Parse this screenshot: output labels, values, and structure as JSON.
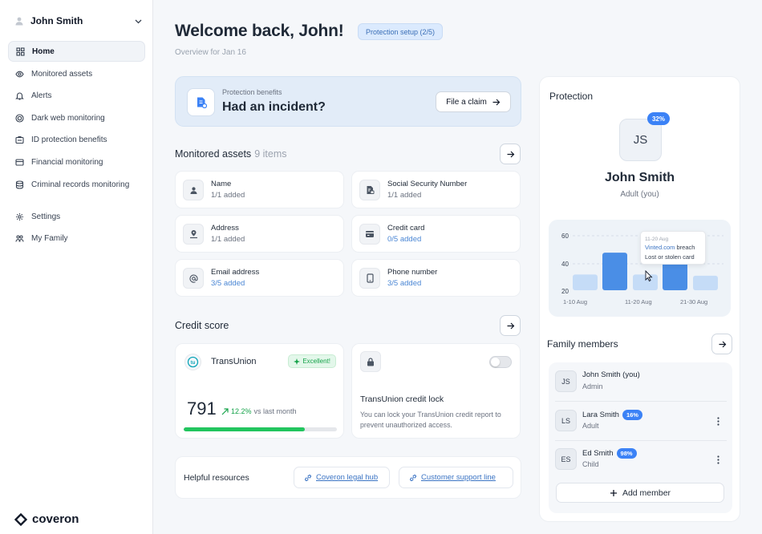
{
  "sidebar": {
    "user_name": "John Smith",
    "items": [
      {
        "label": "Home",
        "icon": "grid-icon",
        "active": true
      },
      {
        "label": "Monitored assets",
        "icon": "eye-icon"
      },
      {
        "label": "Alerts",
        "icon": "bell-icon"
      },
      {
        "label": "Dark web monitoring",
        "icon": "globe-icon"
      },
      {
        "label": "ID protection benefits",
        "icon": "id-card-icon"
      },
      {
        "label": "Financial monitoring",
        "icon": "wallet-icon"
      },
      {
        "label": "Criminal records monitoring",
        "icon": "database-icon"
      }
    ],
    "bottom_items": [
      {
        "label": "Settings",
        "icon": "gear-icon"
      },
      {
        "label": "My Family",
        "icon": "family-icon"
      }
    ],
    "brand": "coveron"
  },
  "header": {
    "title": "Welcome back, John!",
    "setup_badge": "Protection setup (2/5)",
    "subtitle": "Overview for Jan 16"
  },
  "benefits": {
    "label": "Protection benefits",
    "title": "Had an incident?",
    "button": "File a claim"
  },
  "assets": {
    "title": "Monitored assets",
    "count": "9 items",
    "items": [
      {
        "name": "Name",
        "status": "1/1 added",
        "incomplete": false,
        "icon": "user-icon"
      },
      {
        "name": "Social Security Number",
        "status": "1/1 added",
        "incomplete": false,
        "icon": "document-lock-icon"
      },
      {
        "name": "Address",
        "status": "1/1 added",
        "incomplete": false,
        "icon": "map-pin-icon"
      },
      {
        "name": "Credit card",
        "status": "0/5 added",
        "incomplete": true,
        "icon": "credit-card-icon"
      },
      {
        "name": "Email address",
        "status": "3/5 added",
        "incomplete": true,
        "icon": "at-icon"
      },
      {
        "name": "Phone number",
        "status": "3/5 added",
        "incomplete": true,
        "icon": "phone-icon"
      }
    ]
  },
  "credit": {
    "title": "Credit score",
    "bureau": "TransUnion",
    "bureau_logo": "tu",
    "rating": "Excellent!",
    "score": "791",
    "delta": "12.2%",
    "delta_suffix": "vs last month",
    "score_fraction": 0.79,
    "lock_title": "TransUnion credit lock",
    "lock_desc": "You can lock your TransUnion credit report to prevent unauthorized access.",
    "lock_enabled": false
  },
  "resources": {
    "title": "Helpful resources",
    "links": [
      "Coveron legal hub",
      "Customer support line"
    ]
  },
  "protection": {
    "title": "Protection",
    "initials": "JS",
    "percent": "32%",
    "name": "John Smith",
    "role": "Adult (you)"
  },
  "chart_data": {
    "type": "bar",
    "y_ticks": [
      "60",
      "40",
      "20"
    ],
    "ylim": [
      15,
      60
    ],
    "x_labels": [
      "1-10 Aug",
      "11-20 Aug",
      "21-30 Aug"
    ],
    "values": [
      28,
      46,
      28,
      40,
      27
    ],
    "highlighted": [
      false,
      true,
      false,
      true,
      false
    ],
    "tooltip": {
      "date": "11-20 Aug",
      "line1_link": "Vinted.com",
      "line1_rest": " breach",
      "line2": "Lost or stolen card"
    }
  },
  "family": {
    "title": "Family members",
    "members": [
      {
        "initials": "JS",
        "name": "John Smith (you)",
        "role": "Admin",
        "percent": null,
        "menu": false
      },
      {
        "initials": "LS",
        "name": "Lara Smith",
        "role": "Adult",
        "percent": "16%",
        "menu": true
      },
      {
        "initials": "ES",
        "name": "Ed Smith",
        "role": "Child",
        "percent": "98%",
        "menu": true
      }
    ],
    "add_button": "Add member"
  },
  "colors": {
    "accent": "#3b82f6",
    "success": "#22c55e",
    "link": "#3b74c4"
  }
}
